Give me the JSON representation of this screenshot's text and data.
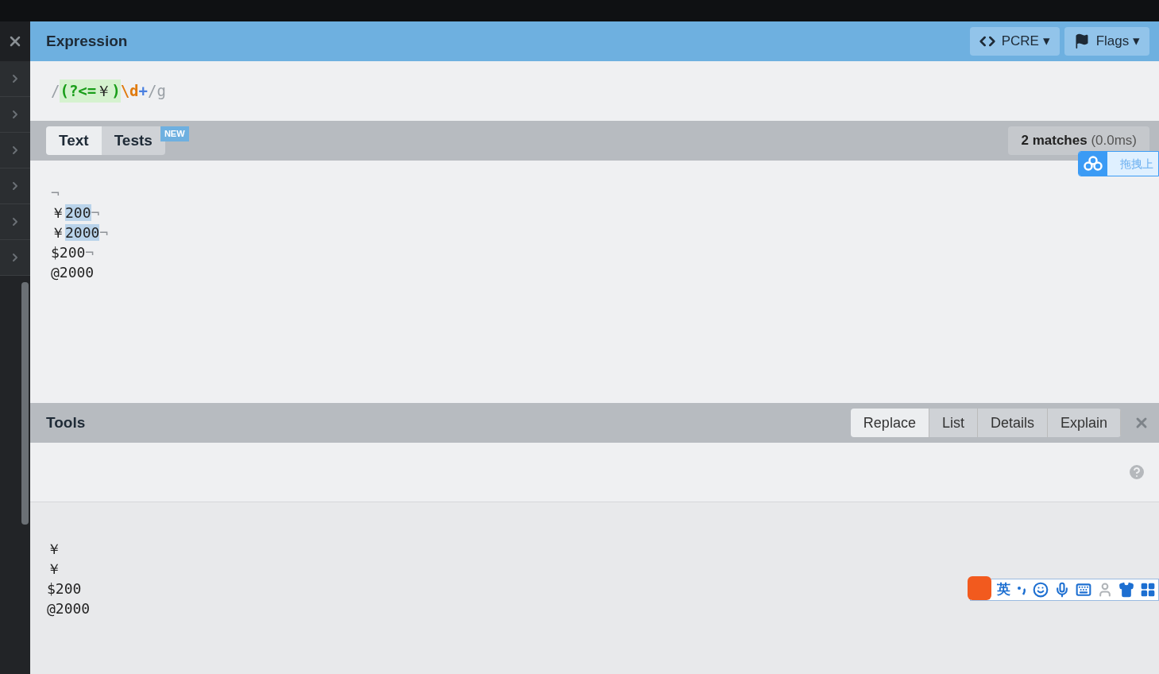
{
  "expression": {
    "title": "Expression",
    "flavor_button": "PCRE",
    "flags_button": "Flags",
    "caret": "▾",
    "tokens": [
      {
        "text": "/",
        "kind": "delimiter"
      },
      {
        "text": "(?<=",
        "kind": "group"
      },
      {
        "text": "￥",
        "kind": "group_literal"
      },
      {
        "text": ")",
        "kind": "group"
      },
      {
        "text": "\\d",
        "kind": "class"
      },
      {
        "text": "+",
        "kind": "quantifier"
      },
      {
        "text": "/g",
        "kind": "delimiter"
      }
    ]
  },
  "tabs": [
    {
      "label": "Text",
      "selected": true
    },
    {
      "label": "Tests",
      "selected": false,
      "badge": "NEW"
    }
  ],
  "matches": {
    "count": "2 matches",
    "time": "(0.0ms)"
  },
  "test_lines": [
    [
      {
        "text": "¬",
        "kind": "eol"
      }
    ],
    [
      {
        "text": "￥",
        "kind": "plain"
      },
      {
        "text": "200",
        "kind": "match"
      },
      {
        "text": "¬",
        "kind": "eol"
      }
    ],
    [
      {
        "text": "￥",
        "kind": "plain"
      },
      {
        "text": "2000",
        "kind": "match"
      },
      {
        "text": "¬",
        "kind": "eol"
      }
    ],
    [
      {
        "text": "$200",
        "kind": "plain"
      },
      {
        "text": "¬",
        "kind": "eol"
      }
    ],
    [
      {
        "text": "@2000",
        "kind": "plain"
      }
    ]
  ],
  "tools": {
    "title": "Tools",
    "tabs": [
      {
        "label": "Replace",
        "selected": true
      },
      {
        "label": "List",
        "selected": false
      },
      {
        "label": "Details",
        "selected": false
      },
      {
        "label": "Explain",
        "selected": false
      }
    ],
    "result_lines": [
      "￥",
      "￥",
      "$200",
      "@2000"
    ]
  },
  "upload_widget": {
    "label": "拖拽上"
  },
  "ime_toolbar": {
    "mode": "英"
  }
}
